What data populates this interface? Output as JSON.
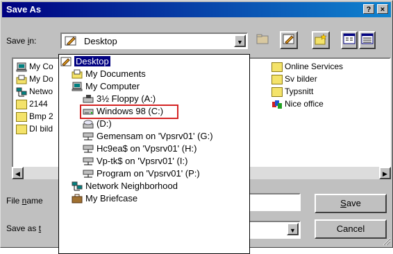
{
  "window": {
    "title": "Save As",
    "help_label": "?",
    "close_label": "×"
  },
  "save_in": {
    "label_pre": "Save ",
    "label_key": "i",
    "label_post": "n:",
    "value": "Desktop"
  },
  "file_list": {
    "left_items": [
      {
        "label": "My Co",
        "icon": "my-computer-icon"
      },
      {
        "label": "My Do",
        "icon": "my-documents-icon"
      },
      {
        "label": "Netwo",
        "icon": "network-icon"
      },
      {
        "label": "2144",
        "icon": "folder-icon"
      },
      {
        "label": "Bmp 2",
        "icon": "folder-icon"
      },
      {
        "label": "DI bild",
        "icon": "folder-icon"
      }
    ],
    "right_items": [
      {
        "label": "Online Services",
        "icon": "folder-icon"
      },
      {
        "label": "Sv bilder",
        "icon": "folder-icon"
      },
      {
        "label": "Typsnitt",
        "icon": "folder-icon"
      },
      {
        "label": "Nice office",
        "icon": "nice-office-icon"
      }
    ]
  },
  "dropdown": {
    "items": [
      {
        "label": "Desktop",
        "icon": "desktop-icon",
        "selected": true
      },
      {
        "label": "My Documents",
        "icon": "my-documents-icon"
      },
      {
        "label": "My Computer",
        "icon": "my-computer-icon"
      },
      {
        "label": "3½ Floppy (A:)",
        "icon": "floppy-icon"
      },
      {
        "label": "Windows 98 (C:)",
        "icon": "hard-drive-icon",
        "highlighted": true
      },
      {
        "label": "(D:)",
        "icon": "cd-drive-icon"
      },
      {
        "label": "Gemensam on 'Vpsrv01' (G:)",
        "icon": "network-drive-icon"
      },
      {
        "label": "Hc9ea$ on 'Vpsrv01' (H:)",
        "icon": "network-drive-icon"
      },
      {
        "label": "Vp-tk$ on 'Vpsrv01' (I:)",
        "icon": "network-drive-icon"
      },
      {
        "label": "Program on 'Vpsrv01' (P:)",
        "icon": "network-drive-icon"
      },
      {
        "label": "Network Neighborhood",
        "icon": "network-icon"
      },
      {
        "label": "My Briefcase",
        "icon": "briefcase-icon"
      }
    ]
  },
  "file_name": {
    "label_pre": "File ",
    "label_key": "n",
    "label_post": "ame",
    "value": ""
  },
  "save_as_type": {
    "label_pre": "Save as ",
    "label_key": "t",
    "value": ""
  },
  "buttons": {
    "save_key": "S",
    "save_rest": "ave",
    "cancel": "Cancel"
  },
  "colors": {
    "title_start": "#000080",
    "title_end": "#1084d0",
    "selection": "#000080",
    "highlight_box": "#d42222",
    "face": "#c0c0c0"
  }
}
